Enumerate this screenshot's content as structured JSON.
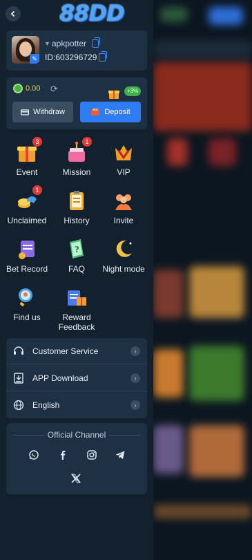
{
  "header": {
    "logo_text": "88DD"
  },
  "profile": {
    "username": "apkpotter",
    "id_label": "ID:",
    "id_value": "603296729"
  },
  "wallet": {
    "balance": "0.00",
    "withdraw_label": "Withdraw",
    "deposit_label": "Deposit",
    "bonus_badge": "+3%"
  },
  "grid": [
    {
      "label": "Event",
      "icon": "event-gift-icon",
      "badge": "3"
    },
    {
      "label": "Mission",
      "icon": "mission-cake-icon",
      "badge": "1"
    },
    {
      "label": "VIP",
      "icon": "vip-crown-icon",
      "badge": ""
    },
    {
      "label": "Unclaimed",
      "icon": "unclaimed-coins-icon",
      "badge": "1"
    },
    {
      "label": "History",
      "icon": "history-clipboard-icon",
      "badge": ""
    },
    {
      "label": "Invite",
      "icon": "invite-people-icon",
      "badge": ""
    },
    {
      "label": "Bet Record",
      "icon": "bet-record-icon",
      "badge": ""
    },
    {
      "label": "FAQ",
      "icon": "faq-book-icon",
      "badge": ""
    },
    {
      "label": "Night mode",
      "icon": "night-mode-moon-icon",
      "badge": ""
    },
    {
      "label": "Find us",
      "icon": "find-us-magnifier-icon",
      "badge": ""
    },
    {
      "label": "Reward Feedback",
      "icon": "reward-feedback-icon",
      "badge": ""
    }
  ],
  "menu": [
    {
      "label": "Customer Service",
      "icon": "headset-icon"
    },
    {
      "label": "APP Download",
      "icon": "download-icon"
    },
    {
      "label": "English",
      "icon": "globe-icon"
    }
  ],
  "channel": {
    "title": "Official Channel",
    "links": [
      "whatsapp-icon",
      "facebook-icon",
      "instagram-icon",
      "telegram-icon",
      "x-icon"
    ]
  },
  "colors": {
    "accent": "#2f7df4",
    "panel": "#1d3044",
    "drawer": "#13202e",
    "badge": "#e03b3b",
    "balance": "#f5d142"
  }
}
